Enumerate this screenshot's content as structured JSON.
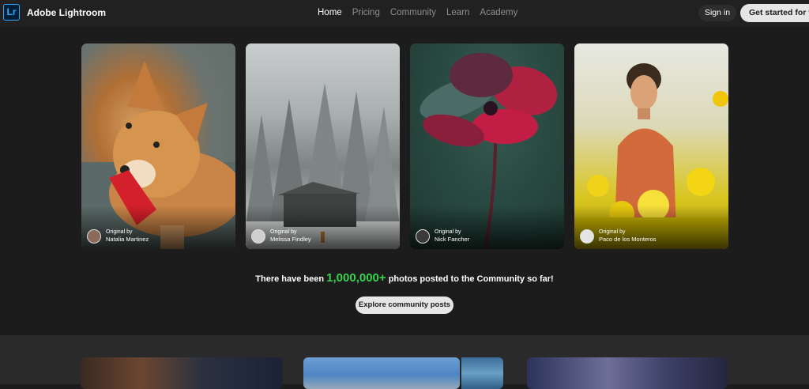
{
  "header": {
    "logo_text": "Lr",
    "brand": "Adobe Lightroom",
    "nav": [
      "Home",
      "Pricing",
      "Community",
      "Learn",
      "Academy"
    ],
    "active_nav": "Home",
    "sign_in": "Sign in",
    "get_started": "Get started for free"
  },
  "photos": [
    {
      "original_by": "Original by",
      "author": "Natalia Martinez"
    },
    {
      "original_by": "Original by",
      "author": "Melissa Findley"
    },
    {
      "original_by": "Original by",
      "author": "Nick Fancher"
    },
    {
      "original_by": "Original by",
      "author": "Paco de los Monteros"
    }
  ],
  "stat": {
    "prefix": "There have been ",
    "count": "1,000,000+",
    "suffix": " photos posted to the Community so far!"
  },
  "explore_button": "Explore community posts",
  "colors": {
    "accent_green": "#3ad14f",
    "logo_blue": "#31a8ff",
    "background": "#1c1c1c"
  }
}
